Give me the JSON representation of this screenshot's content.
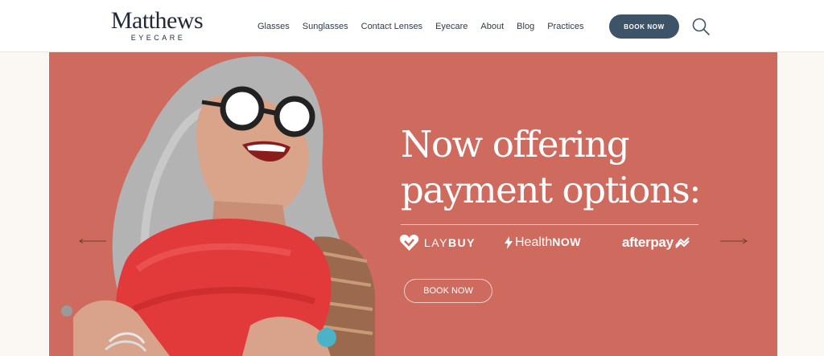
{
  "brand": {
    "name": "Matthews",
    "sub": "EYECARE"
  },
  "nav": [
    "Glasses",
    "Sunglasses",
    "Contact Lenses",
    "Eyecare",
    "About",
    "Blog",
    "Practices"
  ],
  "header": {
    "book_label": "BOOK NOW"
  },
  "icons": {
    "search": "search-icon",
    "prev": "arrow-left-icon",
    "next": "arrow-right-icon"
  },
  "hero": {
    "headline_line1": "Now offering",
    "headline_line2": "payment options:",
    "partners": {
      "laybuy_a": "LAY",
      "laybuy_b": "BUY",
      "health_a": "Health",
      "health_b": "NOW",
      "afterpay": "afterpay"
    },
    "book_label": "BOOK NOW"
  },
  "colors": {
    "hero_bg": "#cf6a5e",
    "button": "#3d5468",
    "page_bg": "#fbf7f3"
  }
}
